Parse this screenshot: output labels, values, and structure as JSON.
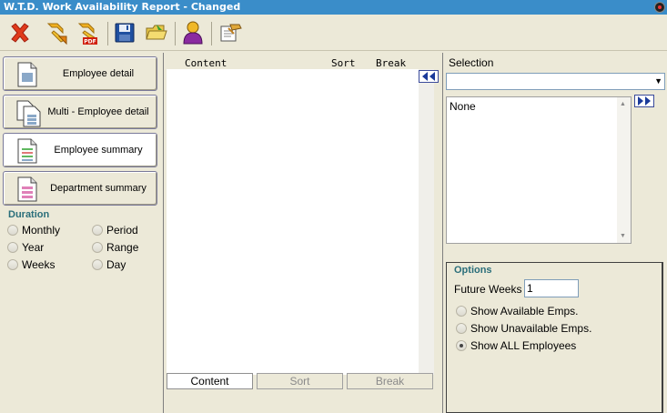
{
  "window": {
    "title": "W.T.D. Work Availability Report - Changed"
  },
  "toolbar": {
    "buttons": [
      {
        "name": "close-button",
        "icon": "red-x-icon"
      },
      {
        "name": "run-report-button",
        "icon": "run-arrow-icon"
      },
      {
        "name": "export-pdf-button",
        "icon": "pdf-export-icon",
        "badge": "PDF"
      },
      {
        "name": "save-button",
        "icon": "floppy-disk-icon"
      },
      {
        "name": "open-folder-button",
        "icon": "folder-icon"
      },
      {
        "name": "user-button",
        "icon": "user-icon"
      },
      {
        "name": "notes-button",
        "icon": "notepad-icon"
      }
    ]
  },
  "reports": [
    {
      "label": "Employee detail",
      "active": false
    },
    {
      "label": "Multi - Employee detail",
      "active": false
    },
    {
      "label": "Employee summary",
      "active": true
    },
    {
      "label": "Department summary",
      "active": false
    }
  ],
  "duration": {
    "title": "Duration",
    "options": [
      "Monthly",
      "Period",
      "Year",
      "Range",
      "Weeks",
      "Day"
    ]
  },
  "content_panel": {
    "headers": {
      "content": "Content",
      "sort": "Sort",
      "break": "Break"
    },
    "tabs": [
      {
        "label": "Content",
        "active": true
      },
      {
        "label": "Sort",
        "active": false
      },
      {
        "label": "Break",
        "active": false
      }
    ]
  },
  "selection": {
    "label": "Selection",
    "dropdown_value": "",
    "items": [
      "None"
    ]
  },
  "options": {
    "title": "Options",
    "future_weeks_label": "Future Weeks",
    "future_weeks_value": "1",
    "radios": [
      {
        "label": "Show Available Emps.",
        "selected": false
      },
      {
        "label": "Show Unavailable Emps.",
        "selected": false
      },
      {
        "label": "Show ALL Employees",
        "selected": true
      }
    ]
  },
  "colors": {
    "title_bar": "#3a8dc9",
    "section_title": "#2a6e7a",
    "window_bg": "#ece9d8"
  }
}
